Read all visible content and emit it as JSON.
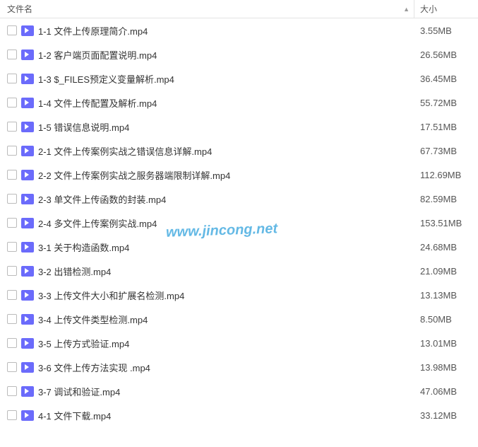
{
  "header": {
    "name_label": "文件名",
    "size_label": "大小",
    "sort_icon": "▲"
  },
  "files": [
    {
      "name": "1-1 文件上传原理简介.mp4",
      "size": "3.55MB"
    },
    {
      "name": "1-2 客户端页面配置说明.mp4",
      "size": "26.56MB"
    },
    {
      "name": "1-3 $_FILES预定义变量解析.mp4",
      "size": "36.45MB"
    },
    {
      "name": "1-4 文件上传配置及解析.mp4",
      "size": "55.72MB"
    },
    {
      "name": "1-5 错误信息说明.mp4",
      "size": "17.51MB"
    },
    {
      "name": "2-1 文件上传案例实战之错误信息详解.mp4",
      "size": "67.73MB"
    },
    {
      "name": "2-2 文件上传案例实战之服务器端限制详解.mp4",
      "size": "112.69MB"
    },
    {
      "name": "2-3 单文件上传函数的封装.mp4",
      "size": "82.59MB"
    },
    {
      "name": "2-4 多文件上传案例实战.mp4",
      "size": "153.51MB"
    },
    {
      "name": "3-1 关于构造函数.mp4",
      "size": "24.68MB"
    },
    {
      "name": "3-2 出错检测.mp4",
      "size": "21.09MB"
    },
    {
      "name": "3-3 上传文件大小和扩展名检测.mp4",
      "size": "13.13MB"
    },
    {
      "name": "3-4 上传文件类型检测.mp4",
      "size": "8.50MB"
    },
    {
      "name": "3-5 上传方式验证.mp4",
      "size": "13.01MB"
    },
    {
      "name": "3-6 文件上传方法实现 .mp4",
      "size": "13.98MB"
    },
    {
      "name": "3-7 调试和验证.mp4",
      "size": "47.06MB"
    },
    {
      "name": "4-1 文件下载.mp4",
      "size": "33.12MB"
    }
  ],
  "watermark": "www.jincong.net"
}
